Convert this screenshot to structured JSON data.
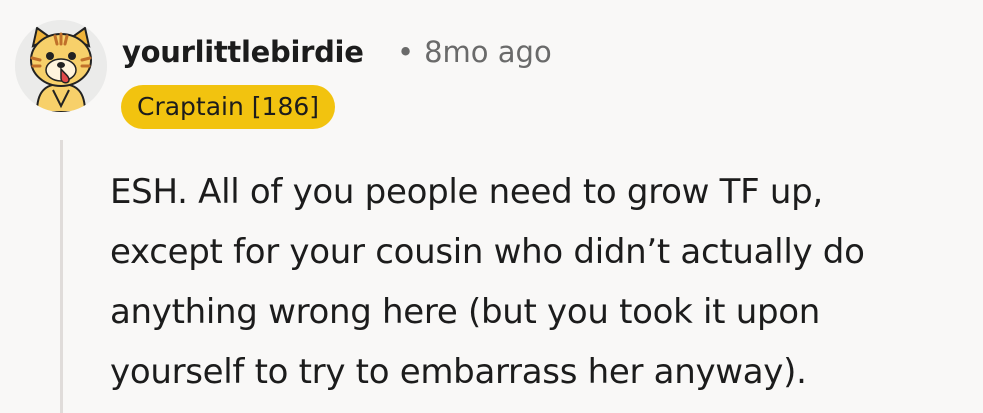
{
  "comment": {
    "author": "yourlittlebirdie",
    "separator": "•",
    "timestamp": "8mo ago",
    "flair": "Craptain [186]",
    "flair_color": "#f2c30f",
    "avatar_icon": "snoo-tiger-avatar-icon",
    "body_lines": [
      "ESH. All of you people need to grow TF up,",
      "except for your cousin who didn’t actually do",
      "anything wrong here (but you took it upon",
      "yourself to try to embarrass her anyway)."
    ]
  }
}
